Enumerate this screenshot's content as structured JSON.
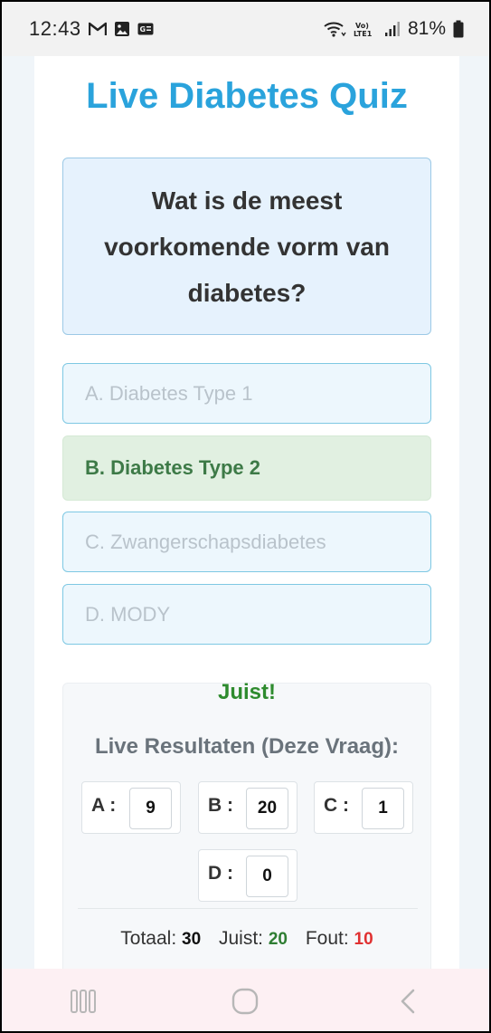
{
  "status_bar": {
    "time": "12:43",
    "left_icons": [
      "gmail-icon",
      "gallery-icon",
      "news-icon"
    ],
    "right_icons": [
      "wifi-icon",
      "volte-icon",
      "signal-icon"
    ],
    "battery": "81%"
  },
  "quiz": {
    "title": "Live Diabetes Quiz",
    "question": "Wat is de meest voorkomende vorm van diabetes?",
    "options": [
      {
        "label": "A. Diabetes Type 1",
        "state": "disabled"
      },
      {
        "label": "B. Diabetes Type 2",
        "state": "correct"
      },
      {
        "label": "C. Zwangerschapsdiabetes",
        "state": "disabled"
      },
      {
        "label": "D. MODY",
        "state": "disabled"
      }
    ],
    "feedback": "Juist!"
  },
  "results": {
    "title": "Live Resultaten (Deze Vraag):",
    "items": [
      {
        "letter": "A :",
        "count": "9"
      },
      {
        "letter": "B :",
        "count": "20"
      },
      {
        "letter": "C :",
        "count": "1"
      },
      {
        "letter": "D :",
        "count": "0"
      }
    ],
    "totals": {
      "total_label": "Totaal:",
      "total_value": "30",
      "correct_label": "Juist:",
      "correct_value": "20",
      "wrong_label": "Fout:",
      "wrong_value": "10"
    }
  },
  "colors": {
    "title": "#2aa3dc",
    "correct_text": "#3d7a47",
    "feedback": "#2e8b2e",
    "wrong": "#e03131"
  }
}
